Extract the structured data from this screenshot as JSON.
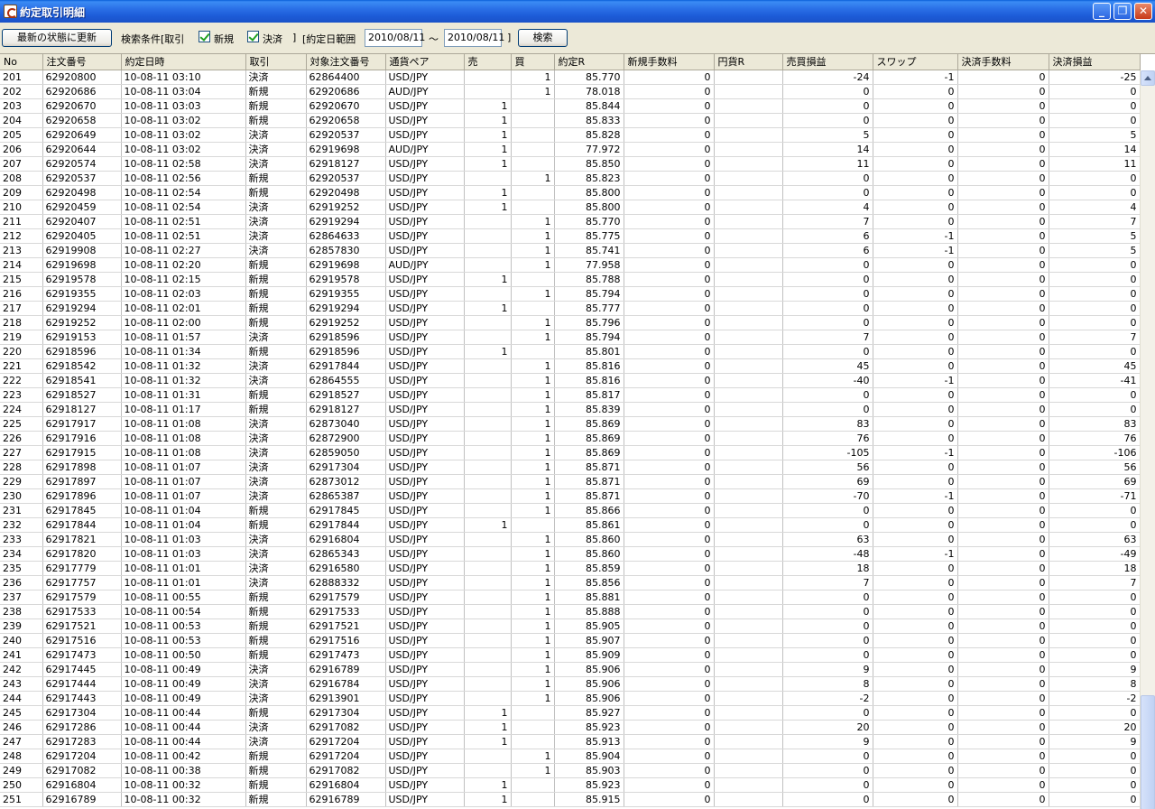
{
  "window": {
    "title": "約定取引明細",
    "minimize": "_",
    "maximize": "❐",
    "close": "✕"
  },
  "toolbar": {
    "refresh_label": "最新の状態に更新",
    "conditions_label": "検索条件[取引",
    "checkbox_new": {
      "label": "新規",
      "checked": true
    },
    "checkbox_settle": {
      "label": "決済",
      "checked": true
    },
    "close_bracket": "]",
    "date_range_label": "[約定日範囲",
    "date_from": "2010/08/11",
    "tilde": "～",
    "date_to": "2010/08/11",
    "date_close_bracket": "]",
    "search_label": "検索"
  },
  "table": {
    "columns": [
      "No",
      "注文番号",
      "約定日時",
      "取引",
      "対象注文番号",
      "通貨ペア",
      "売",
      "買",
      "約定R",
      "新規手数料",
      "円貨R",
      "売買損益",
      "スワップ",
      "決済手数料",
      "決済損益"
    ],
    "rows": [
      [
        "201",
        "62920800",
        "10-08-11 03:10",
        "決済",
        "62864400",
        "USD/JPY",
        "",
        "1",
        "85.770",
        "0",
        "",
        "-24",
        "-1",
        "0",
        "-25"
      ],
      [
        "202",
        "62920686",
        "10-08-11 03:04",
        "新規",
        "62920686",
        "AUD/JPY",
        "",
        "1",
        "78.018",
        "0",
        "",
        "0",
        "0",
        "0",
        "0"
      ],
      [
        "203",
        "62920670",
        "10-08-11 03:03",
        "新規",
        "62920670",
        "USD/JPY",
        "1",
        "",
        "85.844",
        "0",
        "",
        "0",
        "0",
        "0",
        "0"
      ],
      [
        "204",
        "62920658",
        "10-08-11 03:02",
        "新規",
        "62920658",
        "USD/JPY",
        "1",
        "",
        "85.833",
        "0",
        "",
        "0",
        "0",
        "0",
        "0"
      ],
      [
        "205",
        "62920649",
        "10-08-11 03:02",
        "決済",
        "62920537",
        "USD/JPY",
        "1",
        "",
        "85.828",
        "0",
        "",
        "5",
        "0",
        "0",
        "5"
      ],
      [
        "206",
        "62920644",
        "10-08-11 03:02",
        "決済",
        "62919698",
        "AUD/JPY",
        "1",
        "",
        "77.972",
        "0",
        "",
        "14",
        "0",
        "0",
        "14"
      ],
      [
        "207",
        "62920574",
        "10-08-11 02:58",
        "決済",
        "62918127",
        "USD/JPY",
        "1",
        "",
        "85.850",
        "0",
        "",
        "11",
        "0",
        "0",
        "11"
      ],
      [
        "208",
        "62920537",
        "10-08-11 02:56",
        "新規",
        "62920537",
        "USD/JPY",
        "",
        "1",
        "85.823",
        "0",
        "",
        "0",
        "0",
        "0",
        "0"
      ],
      [
        "209",
        "62920498",
        "10-08-11 02:54",
        "新規",
        "62920498",
        "USD/JPY",
        "1",
        "",
        "85.800",
        "0",
        "",
        "0",
        "0",
        "0",
        "0"
      ],
      [
        "210",
        "62920459",
        "10-08-11 02:54",
        "決済",
        "62919252",
        "USD/JPY",
        "1",
        "",
        "85.800",
        "0",
        "",
        "4",
        "0",
        "0",
        "4"
      ],
      [
        "211",
        "62920407",
        "10-08-11 02:51",
        "決済",
        "62919294",
        "USD/JPY",
        "",
        "1",
        "85.770",
        "0",
        "",
        "7",
        "0",
        "0",
        "7"
      ],
      [
        "212",
        "62920405",
        "10-08-11 02:51",
        "決済",
        "62864633",
        "USD/JPY",
        "",
        "1",
        "85.775",
        "0",
        "",
        "6",
        "-1",
        "0",
        "5"
      ],
      [
        "213",
        "62919908",
        "10-08-11 02:27",
        "決済",
        "62857830",
        "USD/JPY",
        "",
        "1",
        "85.741",
        "0",
        "",
        "6",
        "-1",
        "0",
        "5"
      ],
      [
        "214",
        "62919698",
        "10-08-11 02:20",
        "新規",
        "62919698",
        "AUD/JPY",
        "",
        "1",
        "77.958",
        "0",
        "",
        "0",
        "0",
        "0",
        "0"
      ],
      [
        "215",
        "62919578",
        "10-08-11 02:15",
        "新規",
        "62919578",
        "USD/JPY",
        "1",
        "",
        "85.788",
        "0",
        "",
        "0",
        "0",
        "0",
        "0"
      ],
      [
        "216",
        "62919355",
        "10-08-11 02:03",
        "新規",
        "62919355",
        "USD/JPY",
        "",
        "1",
        "85.794",
        "0",
        "",
        "0",
        "0",
        "0",
        "0"
      ],
      [
        "217",
        "62919294",
        "10-08-11 02:01",
        "新規",
        "62919294",
        "USD/JPY",
        "1",
        "",
        "85.777",
        "0",
        "",
        "0",
        "0",
        "0",
        "0"
      ],
      [
        "218",
        "62919252",
        "10-08-11 02:00",
        "新規",
        "62919252",
        "USD/JPY",
        "",
        "1",
        "85.796",
        "0",
        "",
        "0",
        "0",
        "0",
        "0"
      ],
      [
        "219",
        "62919153",
        "10-08-11 01:57",
        "決済",
        "62918596",
        "USD/JPY",
        "",
        "1",
        "85.794",
        "0",
        "",
        "7",
        "0",
        "0",
        "7"
      ],
      [
        "220",
        "62918596",
        "10-08-11 01:34",
        "新規",
        "62918596",
        "USD/JPY",
        "1",
        "",
        "85.801",
        "0",
        "",
        "0",
        "0",
        "0",
        "0"
      ],
      [
        "221",
        "62918542",
        "10-08-11 01:32",
        "決済",
        "62917844",
        "USD/JPY",
        "",
        "1",
        "85.816",
        "0",
        "",
        "45",
        "0",
        "0",
        "45"
      ],
      [
        "222",
        "62918541",
        "10-08-11 01:32",
        "決済",
        "62864555",
        "USD/JPY",
        "",
        "1",
        "85.816",
        "0",
        "",
        "-40",
        "-1",
        "0",
        "-41"
      ],
      [
        "223",
        "62918527",
        "10-08-11 01:31",
        "新規",
        "62918527",
        "USD/JPY",
        "",
        "1",
        "85.817",
        "0",
        "",
        "0",
        "0",
        "0",
        "0"
      ],
      [
        "224",
        "62918127",
        "10-08-11 01:17",
        "新規",
        "62918127",
        "USD/JPY",
        "",
        "1",
        "85.839",
        "0",
        "",
        "0",
        "0",
        "0",
        "0"
      ],
      [
        "225",
        "62917917",
        "10-08-11 01:08",
        "決済",
        "62873040",
        "USD/JPY",
        "",
        "1",
        "85.869",
        "0",
        "",
        "83",
        "0",
        "0",
        "83"
      ],
      [
        "226",
        "62917916",
        "10-08-11 01:08",
        "決済",
        "62872900",
        "USD/JPY",
        "",
        "1",
        "85.869",
        "0",
        "",
        "76",
        "0",
        "0",
        "76"
      ],
      [
        "227",
        "62917915",
        "10-08-11 01:08",
        "決済",
        "62859050",
        "USD/JPY",
        "",
        "1",
        "85.869",
        "0",
        "",
        "-105",
        "-1",
        "0",
        "-106"
      ],
      [
        "228",
        "62917898",
        "10-08-11 01:07",
        "決済",
        "62917304",
        "USD/JPY",
        "",
        "1",
        "85.871",
        "0",
        "",
        "56",
        "0",
        "0",
        "56"
      ],
      [
        "229",
        "62917897",
        "10-08-11 01:07",
        "決済",
        "62873012",
        "USD/JPY",
        "",
        "1",
        "85.871",
        "0",
        "",
        "69",
        "0",
        "0",
        "69"
      ],
      [
        "230",
        "62917896",
        "10-08-11 01:07",
        "決済",
        "62865387",
        "USD/JPY",
        "",
        "1",
        "85.871",
        "0",
        "",
        "-70",
        "-1",
        "0",
        "-71"
      ],
      [
        "231",
        "62917845",
        "10-08-11 01:04",
        "新規",
        "62917845",
        "USD/JPY",
        "",
        "1",
        "85.866",
        "0",
        "",
        "0",
        "0",
        "0",
        "0"
      ],
      [
        "232",
        "62917844",
        "10-08-11 01:04",
        "新規",
        "62917844",
        "USD/JPY",
        "1",
        "",
        "85.861",
        "0",
        "",
        "0",
        "0",
        "0",
        "0"
      ],
      [
        "233",
        "62917821",
        "10-08-11 01:03",
        "決済",
        "62916804",
        "USD/JPY",
        "",
        "1",
        "85.860",
        "0",
        "",
        "63",
        "0",
        "0",
        "63"
      ],
      [
        "234",
        "62917820",
        "10-08-11 01:03",
        "決済",
        "62865343",
        "USD/JPY",
        "",
        "1",
        "85.860",
        "0",
        "",
        "-48",
        "-1",
        "0",
        "-49"
      ],
      [
        "235",
        "62917779",
        "10-08-11 01:01",
        "決済",
        "62916580",
        "USD/JPY",
        "",
        "1",
        "85.859",
        "0",
        "",
        "18",
        "0",
        "0",
        "18"
      ],
      [
        "236",
        "62917757",
        "10-08-11 01:01",
        "決済",
        "62888332",
        "USD/JPY",
        "",
        "1",
        "85.856",
        "0",
        "",
        "7",
        "0",
        "0",
        "7"
      ],
      [
        "237",
        "62917579",
        "10-08-11 00:55",
        "新規",
        "62917579",
        "USD/JPY",
        "",
        "1",
        "85.881",
        "0",
        "",
        "0",
        "0",
        "0",
        "0"
      ],
      [
        "238",
        "62917533",
        "10-08-11 00:54",
        "新規",
        "62917533",
        "USD/JPY",
        "",
        "1",
        "85.888",
        "0",
        "",
        "0",
        "0",
        "0",
        "0"
      ],
      [
        "239",
        "62917521",
        "10-08-11 00:53",
        "新規",
        "62917521",
        "USD/JPY",
        "",
        "1",
        "85.905",
        "0",
        "",
        "0",
        "0",
        "0",
        "0"
      ],
      [
        "240",
        "62917516",
        "10-08-11 00:53",
        "新規",
        "62917516",
        "USD/JPY",
        "",
        "1",
        "85.907",
        "0",
        "",
        "0",
        "0",
        "0",
        "0"
      ],
      [
        "241",
        "62917473",
        "10-08-11 00:50",
        "新規",
        "62917473",
        "USD/JPY",
        "",
        "1",
        "85.909",
        "0",
        "",
        "0",
        "0",
        "0",
        "0"
      ],
      [
        "242",
        "62917445",
        "10-08-11 00:49",
        "決済",
        "62916789",
        "USD/JPY",
        "",
        "1",
        "85.906",
        "0",
        "",
        "9",
        "0",
        "0",
        "9"
      ],
      [
        "243",
        "62917444",
        "10-08-11 00:49",
        "決済",
        "62916784",
        "USD/JPY",
        "",
        "1",
        "85.906",
        "0",
        "",
        "8",
        "0",
        "0",
        "8"
      ],
      [
        "244",
        "62917443",
        "10-08-11 00:49",
        "決済",
        "62913901",
        "USD/JPY",
        "",
        "1",
        "85.906",
        "0",
        "",
        "-2",
        "0",
        "0",
        "-2"
      ],
      [
        "245",
        "62917304",
        "10-08-11 00:44",
        "新規",
        "62917304",
        "USD/JPY",
        "1",
        "",
        "85.927",
        "0",
        "",
        "0",
        "0",
        "0",
        "0"
      ],
      [
        "246",
        "62917286",
        "10-08-11 00:44",
        "決済",
        "62917082",
        "USD/JPY",
        "1",
        "",
        "85.923",
        "0",
        "",
        "20",
        "0",
        "0",
        "20"
      ],
      [
        "247",
        "62917283",
        "10-08-11 00:44",
        "決済",
        "62917204",
        "USD/JPY",
        "1",
        "",
        "85.913",
        "0",
        "",
        "9",
        "0",
        "0",
        "9"
      ],
      [
        "248",
        "62917204",
        "10-08-11 00:42",
        "新規",
        "62917204",
        "USD/JPY",
        "",
        "1",
        "85.904",
        "0",
        "",
        "0",
        "0",
        "0",
        "0"
      ],
      [
        "249",
        "62917082",
        "10-08-11 00:38",
        "新規",
        "62917082",
        "USD/JPY",
        "",
        "1",
        "85.903",
        "0",
        "",
        "0",
        "0",
        "0",
        "0"
      ],
      [
        "250",
        "62916804",
        "10-08-11 00:32",
        "新規",
        "62916804",
        "USD/JPY",
        "1",
        "",
        "85.923",
        "0",
        "",
        "0",
        "0",
        "0",
        "0"
      ],
      [
        "251",
        "62916789",
        "10-08-11 00:32",
        "新規",
        "62916789",
        "USD/JPY",
        "1",
        "",
        "85.915",
        "0",
        "",
        "0",
        "0",
        "0",
        "0"
      ]
    ]
  }
}
